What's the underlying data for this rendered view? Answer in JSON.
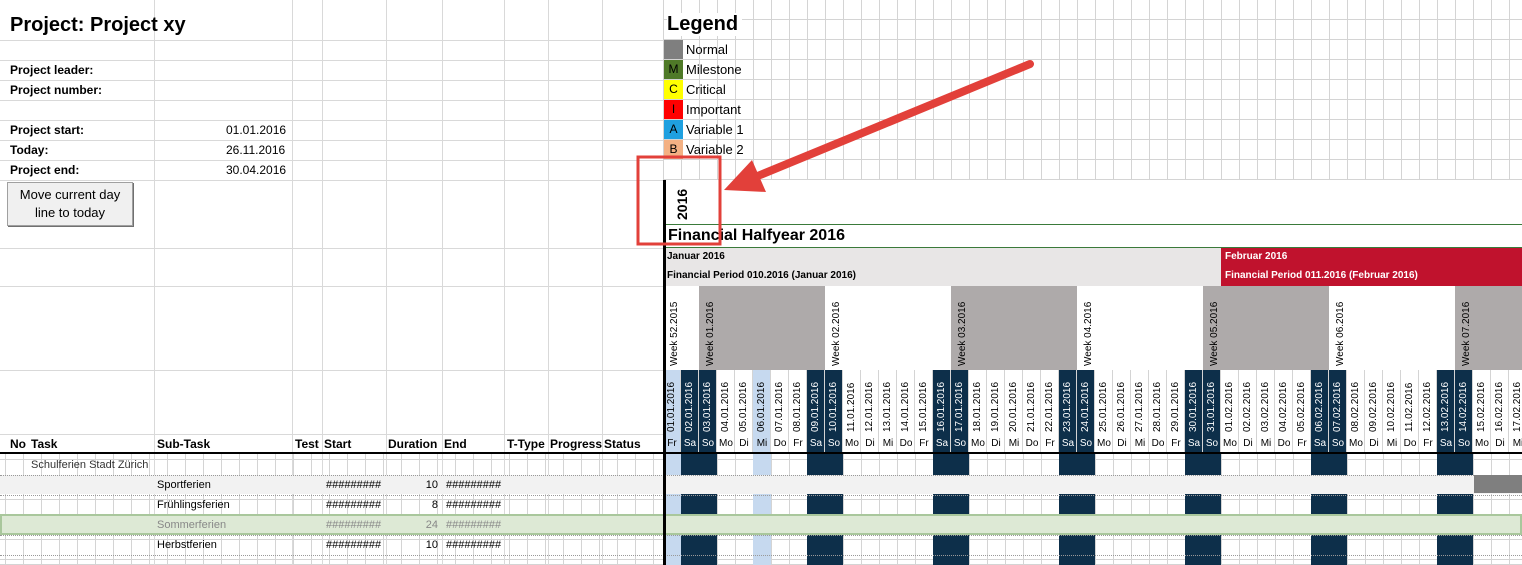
{
  "project": {
    "title": "Project: Project xy",
    "leader_label": "Project leader:",
    "number_label": "Project number:",
    "start_label": "Project start:",
    "start_value": "01.01.2016",
    "today_label": "Today:",
    "today_value": "26.11.2016",
    "end_label": "Project end:",
    "end_value": "30.04.2016",
    "move_button": "Move current day line to today"
  },
  "legend": {
    "title": "Legend",
    "items": [
      {
        "code": "",
        "label": "Normal",
        "color": "#7f7f7f"
      },
      {
        "code": "M",
        "label": "Milestone",
        "color": "#4f7a28"
      },
      {
        "code": "C",
        "label": "Critical",
        "color": "#ffff00"
      },
      {
        "code": "I",
        "label": "Important",
        "color": "#ff0000"
      },
      {
        "code": "A",
        "label": "Variable 1",
        "color": "#1fa0e0"
      },
      {
        "code": "B",
        "label": "Variable 2",
        "color": "#f4b183"
      }
    ]
  },
  "timeline": {
    "year": "2016",
    "fiscal_halfyear": "Financial Halfyear 2016",
    "months": [
      {
        "name": "Januar 2016",
        "period": "Financial Period 010.2016 (Januar 2016)"
      },
      {
        "name": "Februar 2016",
        "period": "Financial Period 011.2016 (Februar 2016)"
      }
    ],
    "weeks": [
      "Week 52.2015",
      "Week 01.2016",
      "Week 02.2016",
      "Week 03.2016",
      "Week 04.2016",
      "Week 05.2016",
      "Week 06.2016",
      "Week 07.2016"
    ],
    "dates": [
      {
        "date": "01.01.2016",
        "day": "Fr"
      },
      {
        "date": "02.01.2016",
        "day": "Sa"
      },
      {
        "date": "03.01.2016",
        "day": "So"
      },
      {
        "date": "04.01.2016",
        "day": "Mo"
      },
      {
        "date": "05.01.2016",
        "day": "Di"
      },
      {
        "date": "06.01.2016",
        "day": "Mi"
      },
      {
        "date": "07.01.2016",
        "day": "Do"
      },
      {
        "date": "08.01.2016",
        "day": "Fr"
      },
      {
        "date": "09.01.2016",
        "day": "Sa"
      },
      {
        "date": "10.01.2016",
        "day": "So"
      },
      {
        "date": "11.01.2016",
        "day": "Mo"
      },
      {
        "date": "12.01.2016",
        "day": "Di"
      },
      {
        "date": "13.01.2016",
        "day": "Mi"
      },
      {
        "date": "14.01.2016",
        "day": "Do"
      },
      {
        "date": "15.01.2016",
        "day": "Fr"
      },
      {
        "date": "16.01.2016",
        "day": "Sa"
      },
      {
        "date": "17.01.2016",
        "day": "So"
      },
      {
        "date": "18.01.2016",
        "day": "Mo"
      },
      {
        "date": "19.01.2016",
        "day": "Di"
      },
      {
        "date": "20.01.2016",
        "day": "Mi"
      },
      {
        "date": "21.01.2016",
        "day": "Do"
      },
      {
        "date": "22.01.2016",
        "day": "Fr"
      },
      {
        "date": "23.01.2016",
        "day": "Sa"
      },
      {
        "date": "24.01.2016",
        "day": "So"
      },
      {
        "date": "25.01.2016",
        "day": "Mo"
      },
      {
        "date": "26.01.2016",
        "day": "Di"
      },
      {
        "date": "27.01.2016",
        "day": "Mi"
      },
      {
        "date": "28.01.2016",
        "day": "Do"
      },
      {
        "date": "29.01.2016",
        "day": "Fr"
      },
      {
        "date": "30.01.2016",
        "day": "Sa"
      },
      {
        "date": "31.01.2016",
        "day": "So"
      },
      {
        "date": "01.02.2016",
        "day": "Mo"
      },
      {
        "date": "02.02.2016",
        "day": "Di"
      },
      {
        "date": "03.02.2016",
        "day": "Mi"
      },
      {
        "date": "04.02.2016",
        "day": "Do"
      },
      {
        "date": "05.02.2016",
        "day": "Fr"
      },
      {
        "date": "06.02.2016",
        "day": "Sa"
      },
      {
        "date": "07.02.2016",
        "day": "So"
      },
      {
        "date": "08.02.2016",
        "day": "Mo"
      },
      {
        "date": "09.02.2016",
        "day": "Di"
      },
      {
        "date": "10.02.2016",
        "day": "Mi"
      },
      {
        "date": "11.02.2016",
        "day": "Do"
      },
      {
        "date": "12.02.2016",
        "day": "Fr"
      },
      {
        "date": "13.02.2016",
        "day": "Sa"
      },
      {
        "date": "14.02.2016",
        "day": "So"
      },
      {
        "date": "15.02.2016",
        "day": "Mo"
      },
      {
        "date": "16.02.2016",
        "day": "Di"
      },
      {
        "date": "17.02.2016",
        "day": "Mi"
      }
    ]
  },
  "columns": {
    "no": "No",
    "task": "Task",
    "subtask": "Sub-Task",
    "test": "Test",
    "start": "Start",
    "duration": "Duration",
    "end": "End",
    "ttype": "T-Type",
    "progress": "Progress",
    "status": "Status"
  },
  "rows": [
    {
      "task": "Schulferien Stadt Zürich",
      "subtask": "",
      "start": "",
      "duration": "",
      "end": ""
    },
    {
      "task": "",
      "subtask": "Sportferien",
      "start": "#########",
      "duration": "10",
      "end": "#########"
    },
    {
      "task": "",
      "subtask": "Frühlingsferien",
      "start": "#########",
      "duration": "8",
      "end": "#########"
    },
    {
      "task": "",
      "subtask": "Sommerferien",
      "start": "#########",
      "duration": "24",
      "end": "#########"
    },
    {
      "task": "",
      "subtask": "Herbstferien",
      "start": "#########",
      "duration": "10",
      "end": "#########"
    }
  ],
  "colors": {
    "weekend": "#0d2f4a",
    "feb_header": "#c0122d",
    "jan_header": "#e8e6e6",
    "week_block": "#aeaaaa",
    "highlight_row": "#dde9d5",
    "annotation_red": "#e2403a"
  }
}
